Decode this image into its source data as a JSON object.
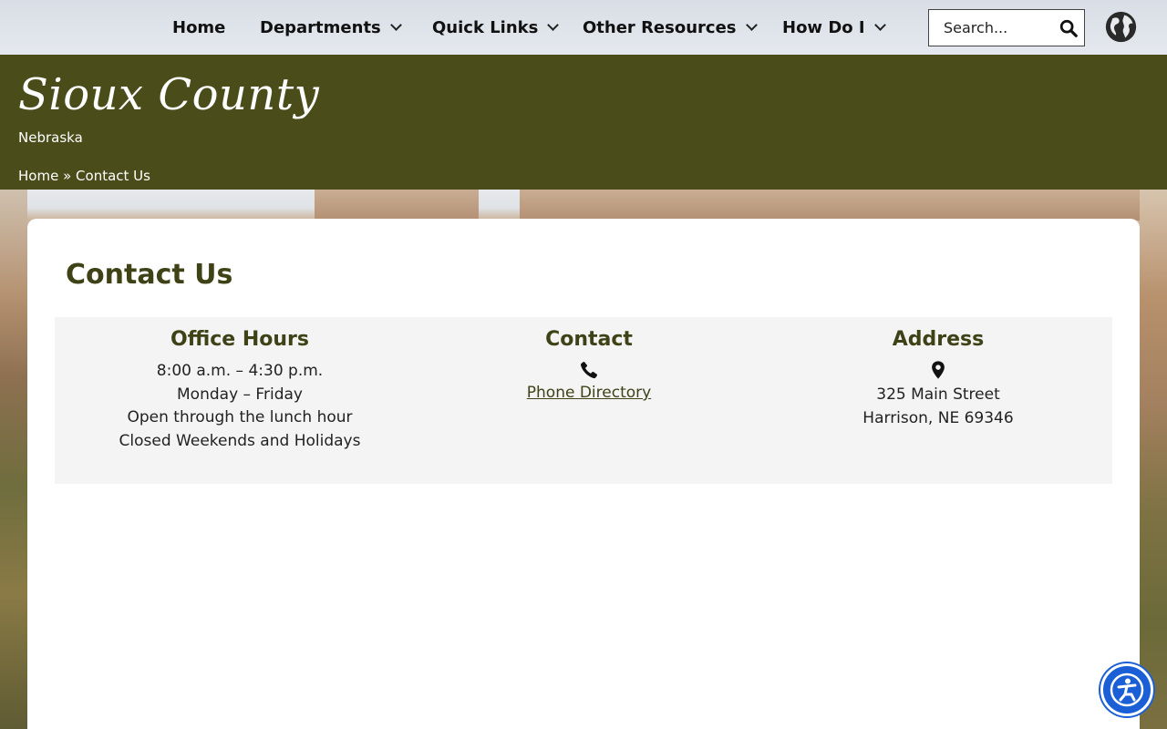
{
  "nav": {
    "items": [
      {
        "label": "Home"
      },
      {
        "label": "Departments"
      },
      {
        "label": "Quick Links"
      },
      {
        "label": "Other Resources"
      },
      {
        "label": "How Do I"
      }
    ],
    "search_placeholder": "Search..."
  },
  "header": {
    "title": "Sioux County",
    "subtitle": "Nebraska",
    "breadcrumb_home": "Home",
    "breadcrumb_sep": "»",
    "breadcrumb_current": "Contact Us"
  },
  "main": {
    "title": "Contact Us",
    "office": {
      "heading": "Office Hours",
      "lines": [
        "8:00 a.m. – 4:30 p.m.",
        "Monday – Friday",
        "Open through the lunch hour",
        "Closed Weekends and Holidays"
      ]
    },
    "contact": {
      "heading": "Contact",
      "link": "Phone Directory"
    },
    "address": {
      "heading": "Address",
      "lines": [
        "325 Main Street",
        "Harrison, NE 69346"
      ]
    }
  },
  "colors": {
    "header_bg": "#4a4d1a",
    "accent_text": "#3e4216",
    "a11y_bg": "#1a5fd6"
  },
  "icons": [
    "chevron-down-icon",
    "search-icon",
    "globe-icon",
    "phone-icon",
    "map-pin-icon",
    "accessibility-icon"
  ]
}
